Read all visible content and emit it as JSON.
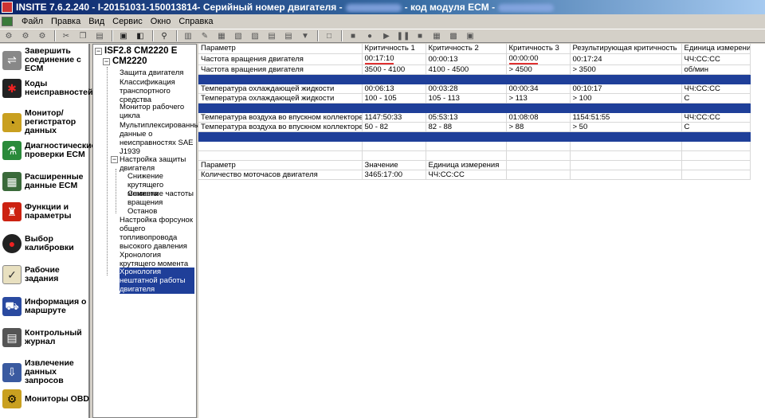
{
  "window": {
    "title_left": "INSITE 7.6.2.240  - I-20151031-150013814- Серийный номер двигателя -",
    "title_right": "- код модуля ECM -"
  },
  "menu": [
    "Файл",
    "Правка",
    "Вид",
    "Сервис",
    "Окно",
    "Справка"
  ],
  "sidebar": [
    {
      "label": "Завершить соединение с ECM",
      "icon": "disconnect-icon"
    },
    {
      "label": "Коды неисправностей",
      "icon": "fault-codes-icon"
    },
    {
      "label": "Монитор/регистратор данных",
      "icon": "monitor-icon"
    },
    {
      "label": "Диагностические проверки ECM",
      "icon": "flask-icon"
    },
    {
      "label": "Расширенные данные ECM",
      "icon": "data-icon"
    },
    {
      "label": "Функции и параметры",
      "icon": "chair-icon"
    },
    {
      "label": "Выбор калибровки",
      "icon": "disc-icon"
    },
    {
      "label": "Рабочие задания",
      "icon": "clipboard-icon"
    },
    {
      "label": "Информация о маршруте",
      "icon": "truck-icon"
    },
    {
      "label": "Контрольный журнал",
      "icon": "journal-icon"
    },
    {
      "label": "Извлечение данных запросов",
      "icon": "extract-icon"
    },
    {
      "label": "Мониторы OBD",
      "icon": "obd-icon"
    }
  ],
  "tree": {
    "root": "ISF2.8 CM2220 E",
    "sub": "CM2220",
    "nodes": [
      "Защита двигателя",
      "Классификация транспортного средства",
      "Монитор рабочего цикла",
      "Мультиплексированные данные о неисправностях SAE J1939",
      "Настройка защиты двигателя",
      "Снижение крутящего момента",
      "Снижение частоты вращения",
      "Останов",
      "Настройка форсунок общего топливопровода высокого давления",
      "Хронология крутящего момента двигателя",
      "Хронология нештатной работы двигателя"
    ]
  },
  "table": {
    "headers": [
      "Параметр",
      "Критичность 1",
      "Критичность 2",
      "Критичность 3",
      "Результирующая критичность",
      "Единица измерения"
    ],
    "rows": [
      [
        "Частота вращения двигателя",
        "00:17:10",
        "00:00:13",
        "00:00:00",
        "00:17:24",
        "ЧЧ:СС:СС"
      ],
      [
        "Частота вращения двигателя",
        "3500 - 4100",
        "4100 - 4500",
        "> 4500",
        "> 3500",
        "об/мин"
      ],
      [
        "Температура охлаждающей жидкости",
        "00:06:13",
        "00:03:28",
        "00:00:34",
        "00:10:17",
        "ЧЧ:СС:СС"
      ],
      [
        "Температура охлаждающей жидкости",
        "100 - 105",
        "105 - 113",
        "> 113",
        "> 100",
        "C"
      ],
      [
        "Температура воздуха во впускном коллекторе",
        "1147:50:33",
        "05:53:13",
        "01:08:08",
        "1154:51:55",
        "ЧЧ:СС:СС"
      ],
      [
        "Температура воздуха во впускном коллекторе",
        "50 - 82",
        "82 - 88",
        "> 88",
        "> 50",
        "C"
      ]
    ],
    "sub_headers": [
      "Параметр",
      "Значение",
      "Единица измерения"
    ],
    "sub_row": [
      "Количество моточасов двигателя",
      "3465:17:00",
      "ЧЧ:СС:СС"
    ]
  }
}
